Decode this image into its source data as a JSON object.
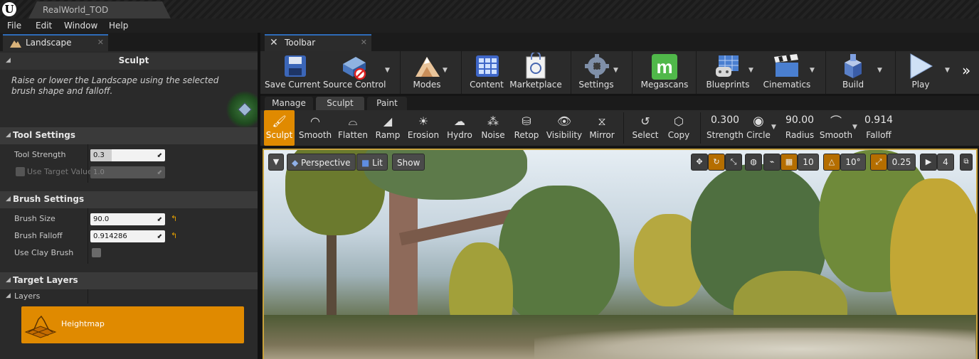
{
  "titlebar": {
    "document_tab": "RealWorld_TOD"
  },
  "menubar": {
    "items": [
      "File",
      "Edit",
      "Window",
      "Help"
    ]
  },
  "left_panel": {
    "tab_label": "Landscape",
    "mode_title": "Sculpt",
    "description": "Raise or lower the Landscape using the selected brush shape and falloff.",
    "sections": {
      "tool_settings": "Tool Settings",
      "brush_settings": "Brush Settings",
      "target_layers": "Target Layers"
    },
    "tool_strength": {
      "label": "Tool Strength",
      "value": "0.3"
    },
    "use_target_value": {
      "label": "Use Target Value",
      "value": "1.0"
    },
    "brush_size": {
      "label": "Brush Size",
      "value": "90.0"
    },
    "brush_falloff": {
      "label": "Brush Falloff",
      "value": "0.914286"
    },
    "use_clay_brush": {
      "label": "Use Clay Brush",
      "checked": false
    },
    "layers_label": "Layers",
    "heightmap": "Heightmap"
  },
  "toolbar": {
    "tab_label": "Toolbar",
    "buttons": {
      "save_current": "Save Current",
      "source_control": "Source Control",
      "modes": "Modes",
      "content": "Content",
      "marketplace": "Marketplace",
      "settings": "Settings",
      "megascans": "Megascans",
      "blueprints": "Blueprints",
      "cinematics": "Cinematics",
      "build": "Build",
      "play": "Play"
    }
  },
  "mode_tabs": {
    "manage": "Manage",
    "sculpt": "Sculpt",
    "paint": "Paint"
  },
  "sculpt_tools": {
    "sculpt": "Sculpt",
    "smooth": "Smooth",
    "flatten": "Flatten",
    "ramp": "Ramp",
    "erosion": "Erosion",
    "hydro": "Hydro",
    "noise": "Noise",
    "retop": "Retop",
    "visibility": "Visibility",
    "mirror": "Mirror",
    "select": "Select",
    "copy": "Copy"
  },
  "brush_bar": {
    "strength": {
      "value": "0.300",
      "label": "Strength"
    },
    "circle": {
      "label": "Circle"
    },
    "radius": {
      "value": "90.00",
      "label": "Radius"
    },
    "smooth": {
      "label": "Smooth"
    },
    "falloff": {
      "value": "0.914",
      "label": "Falloff"
    }
  },
  "viewport": {
    "perspective": "Perspective",
    "lit": "Lit",
    "show": "Show",
    "grid_snap": "10",
    "rotation_snap": "10°",
    "scale_snap": "0.25",
    "camera_speed": "4"
  },
  "colors": {
    "accent": "#e08a00",
    "tab_highlight": "#2e6bb8",
    "viewport_border": "#c8a23c"
  }
}
